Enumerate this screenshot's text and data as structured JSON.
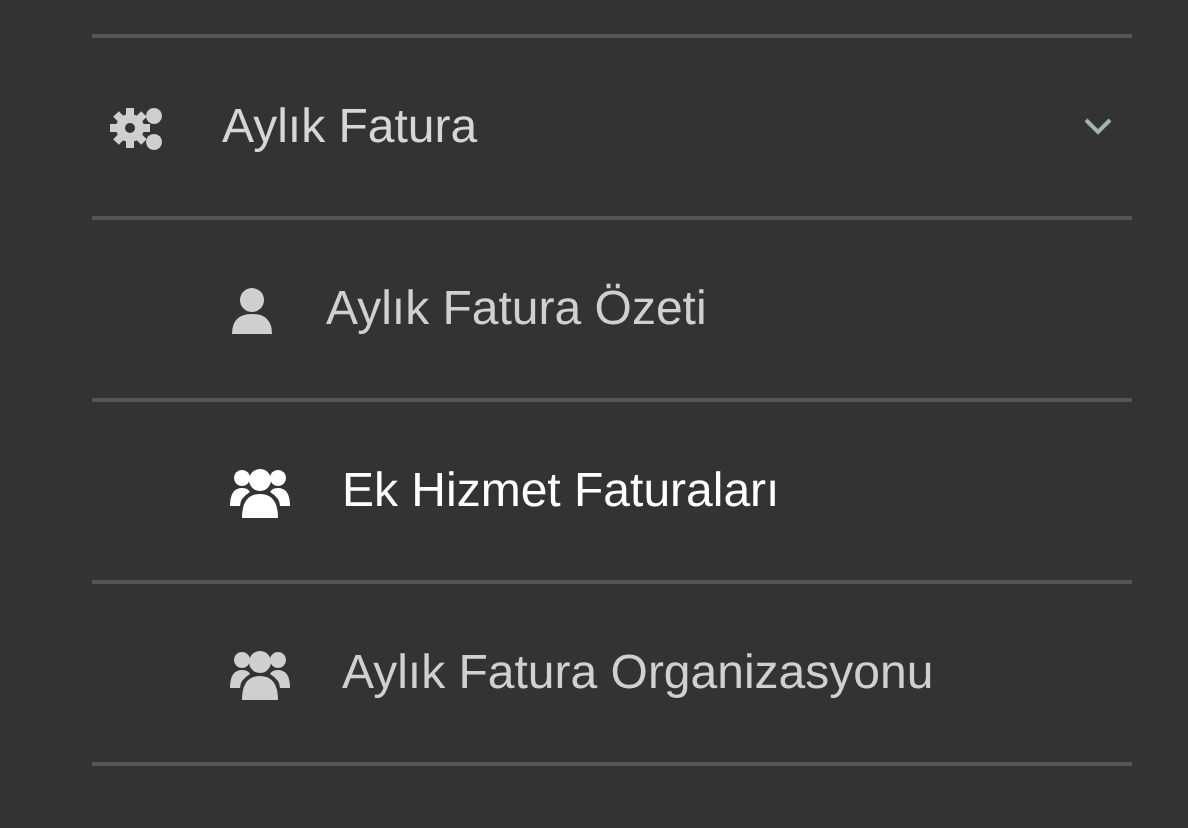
{
  "menu": {
    "label": "Aylık Fatura",
    "expanded": true,
    "children": [
      {
        "label": "Aylık Fatura Özeti",
        "kind": "user",
        "selected": false
      },
      {
        "label": "Ek Hizmet Faturaları",
        "kind": "group",
        "selected": true
      },
      {
        "label": "Aylık Fatura Organizasyonu",
        "kind": "group",
        "selected": false
      }
    ]
  }
}
